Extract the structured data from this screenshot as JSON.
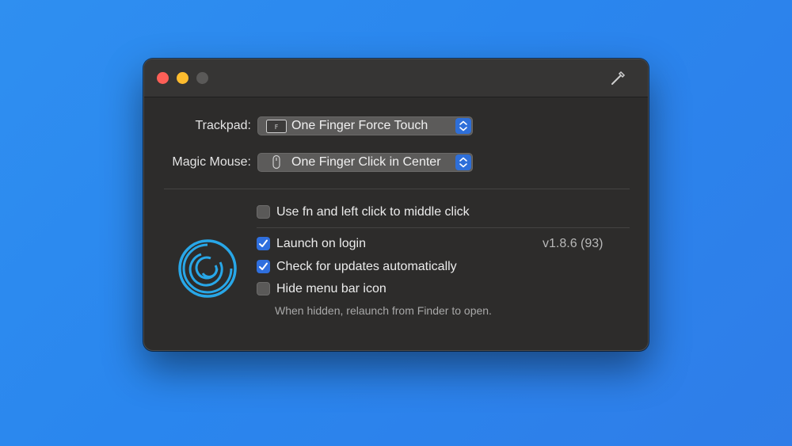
{
  "trackpad": {
    "label": "Trackpad:",
    "value": "One Finger Force Touch",
    "icon": "force-touch-key-icon"
  },
  "mouse": {
    "label": "Magic Mouse:",
    "value": "One Finger Click in Center",
    "icon": "magic-mouse-icon"
  },
  "options": {
    "fn_click": {
      "label": "Use fn and left click to middle click",
      "checked": false
    },
    "launch_login": {
      "label": "Launch on login",
      "checked": true
    },
    "check_updates": {
      "label": "Check for updates automatically",
      "checked": true
    },
    "hide_icon": {
      "label": "Hide menu bar icon",
      "checked": false
    },
    "hide_hint": "When hidden, relaunch from Finder to open."
  },
  "version": "v1.8.6 (93)",
  "colors": {
    "accent": "#2f6fde",
    "window_bg": "#2d2c2b",
    "desktop": "#2f8ff0",
    "logo": "#28a7e8"
  }
}
